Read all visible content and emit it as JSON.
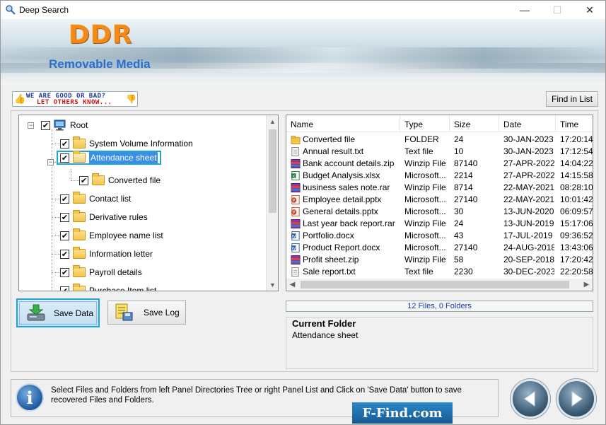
{
  "window": {
    "title": "Deep Search",
    "minimize_glyph": "—",
    "maximize_glyph": "☐",
    "close_glyph": "✕"
  },
  "banner": {
    "logo": "DDR",
    "subtitle": "Removable Media"
  },
  "feedback": {
    "line1": "WE ARE GOOD OR BAD?",
    "line2": "LET OTHERS KNOW..."
  },
  "toolbar": {
    "find_label": "Find in List"
  },
  "tree": {
    "check_glyph": "✔",
    "items": [
      {
        "label": "Root",
        "icon": "computer-icon"
      },
      {
        "label": "System Volume Information",
        "icon": "folder-icon"
      },
      {
        "label": "Attendance sheet",
        "icon": "folder-open-icon",
        "selected": true
      },
      {
        "label": "Converted file",
        "icon": "folder-icon"
      },
      {
        "label": "Contact list",
        "icon": "folder-icon"
      },
      {
        "label": "Derivative rules",
        "icon": "folder-icon"
      },
      {
        "label": "Employee name list",
        "icon": "folder-icon"
      },
      {
        "label": "Information letter",
        "icon": "folder-icon"
      },
      {
        "label": "Payroll details",
        "icon": "folder-icon"
      },
      {
        "label": "Purchase Item list",
        "icon": "folder-icon"
      }
    ]
  },
  "list": {
    "columns": [
      "Name",
      "Type",
      "Size",
      "Date",
      "Time"
    ],
    "rows": [
      {
        "name": "Converted file",
        "type": "FOLDER",
        "size": "24",
        "date": "30-JAN-2023",
        "time": "17:20:14",
        "icon": "folder-icon"
      },
      {
        "name": "Annual result.txt",
        "type": "Text file",
        "size": "10",
        "date": "30-JAN-2023",
        "time": "17:12:54",
        "icon": "text-file-icon"
      },
      {
        "name": "Bank account details.zip",
        "type": "Winzip File",
        "size": "87140",
        "date": "27-APR-2022",
        "time": "14:04:22",
        "icon": "zip-file-icon"
      },
      {
        "name": "Budget Analysis.xlsx",
        "type": "Microsoft...",
        "size": "2214",
        "date": "27-APR-2022",
        "time": "14:15:58",
        "icon": "excel-file-icon"
      },
      {
        "name": "business sales note.rar",
        "type": "Winzip File",
        "size": "8714",
        "date": "22-MAY-2021",
        "time": "08:28:10",
        "icon": "zip-file-icon"
      },
      {
        "name": "Employee detail.pptx",
        "type": "Microsoft...",
        "size": "27140",
        "date": "22-MAY-2021",
        "time": "10:01:42",
        "icon": "powerpoint-file-icon"
      },
      {
        "name": "General details.pptx",
        "type": "Microsoft...",
        "size": "30",
        "date": "13-JUN-2020",
        "time": "06:09:57",
        "icon": "powerpoint-file-icon"
      },
      {
        "name": "Last year back report.rar",
        "type": "Winzip File",
        "size": "24",
        "date": "13-JUN-2019",
        "time": "15:17:06",
        "icon": "zip-file-icon"
      },
      {
        "name": "Portfolio.docx",
        "type": "Microsoft...",
        "size": "43",
        "date": "17-JUL-2019",
        "time": "09:36:52",
        "icon": "word-file-icon"
      },
      {
        "name": "Product Report.docx",
        "type": "Microsoft...",
        "size": "27140",
        "date": "24-AUG-2018",
        "time": "13:43:06",
        "icon": "word-file-icon"
      },
      {
        "name": "Profit sheet.zip",
        "type": "Winzip File",
        "size": "58",
        "date": "20-SEP-2018",
        "time": "17:20:42",
        "icon": "zip-file-icon"
      },
      {
        "name": "Sale report.txt",
        "type": "Text file",
        "size": "2230",
        "date": "30-DEC-2023",
        "time": "22:20:58",
        "icon": "text-file-icon"
      }
    ]
  },
  "buttons": {
    "save_data": "Save Data",
    "save_log": "Save Log"
  },
  "status": {
    "summary": "12 Files, 0 Folders"
  },
  "current_folder": {
    "title": "Current Folder",
    "value": "Attendance sheet"
  },
  "help": {
    "text": "Select Files and Folders from left Panel Directories Tree or right Panel List and Click on 'Save Data' button to save recovered Files and Folders."
  },
  "watermark": "F-Find.com",
  "colors": {
    "accent": "#1aa6d8",
    "logo": "#f08a1c",
    "subtitle": "#2a6fd0",
    "selection": "#3a8ee6"
  }
}
